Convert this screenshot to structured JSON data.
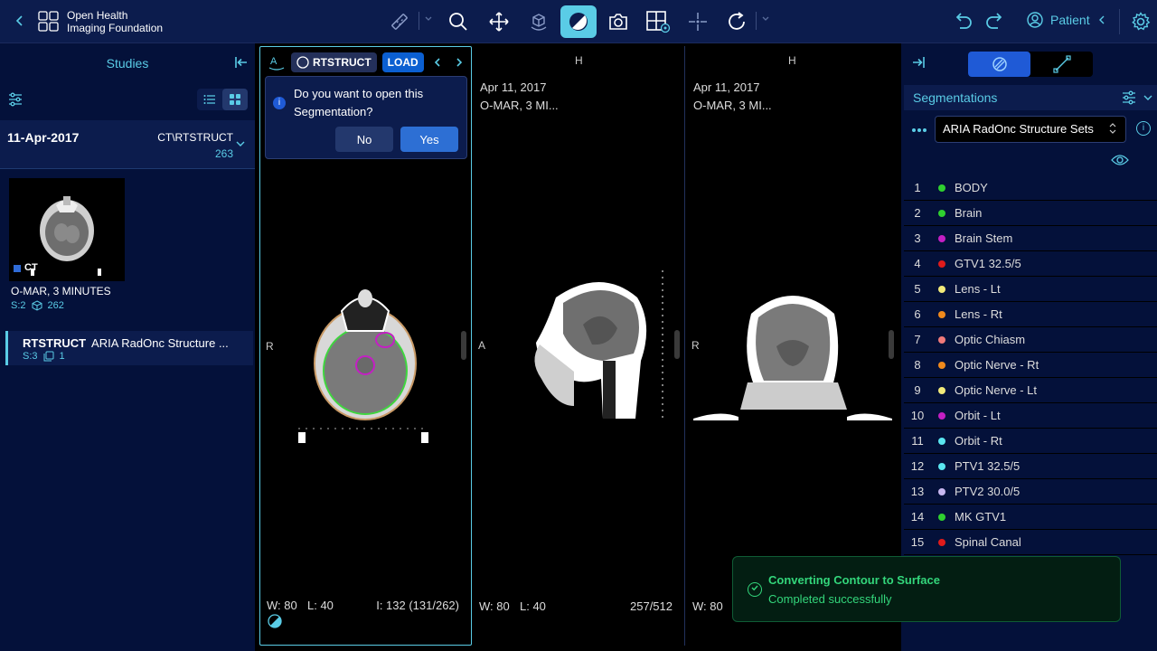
{
  "header": {
    "logo_line1": "Open Health",
    "logo_line2": "Imaging Foundation",
    "patient_label": "Patient"
  },
  "left_panel": {
    "title": "Studies",
    "study": {
      "date": "11-Apr-2017",
      "modalities": "CT\\RTSTRUCT",
      "instance_count": "263"
    },
    "series_thumbnail": {
      "badge": "CT",
      "description": "O-MAR, 3 MINUTES",
      "series_number": "S:2",
      "instance_count": "262"
    },
    "rtstruct_item": {
      "modality": "RTSTRUCT",
      "description": "ARIA RadOnc Structure ...",
      "series_number": "S:3",
      "instance_count": "1"
    }
  },
  "viewport1": {
    "seg_label": "RTSTRUCT",
    "load_label": "LOAD",
    "prompt_text": "Do you want to open this Segmentation?",
    "no_label": "No",
    "yes_label": "Yes",
    "orient_left": "R",
    "window": "W: 80",
    "level": "L: 40",
    "image_index": "I: 132 (131/262)"
  },
  "viewport2": {
    "orient_top": "H",
    "orient_left": "A",
    "date": "Apr 11, 2017",
    "series": "O-MAR, 3 MI...",
    "window": "W: 80",
    "level": "L: 40",
    "slice": "257/512"
  },
  "viewport3": {
    "orient_top": "H",
    "orient_left": "R",
    "date": "Apr 11, 2017",
    "series": "O-MAR, 3 MI...",
    "window": "W: 80"
  },
  "right_panel": {
    "segmentations_title": "Segmentations",
    "selected_set": "ARIA RadOnc Structure Sets",
    "segments": [
      {
        "num": "1",
        "label": "BODY",
        "color": "#2fd02f"
      },
      {
        "num": "2",
        "label": "Brain",
        "color": "#2fd02f"
      },
      {
        "num": "3",
        "label": "Brain Stem",
        "color": "#c41fc4"
      },
      {
        "num": "4",
        "label": "GTV1 32.5/5",
        "color": "#e01b1b"
      },
      {
        "num": "5",
        "label": "Lens - Lt",
        "color": "#f2ea7a"
      },
      {
        "num": "6",
        "label": "Lens - Rt",
        "color": "#f08a1c"
      },
      {
        "num": "7",
        "label": "Optic Chiasm",
        "color": "#f07a7a"
      },
      {
        "num": "8",
        "label": "Optic Nerve - Rt",
        "color": "#f08a1c"
      },
      {
        "num": "9",
        "label": "Optic Nerve - Lt",
        "color": "#f2ea7a"
      },
      {
        "num": "10",
        "label": "Orbit - Lt",
        "color": "#c41fc4"
      },
      {
        "num": "11",
        "label": "Orbit - Rt",
        "color": "#5ae6f0"
      },
      {
        "num": "12",
        "label": "PTV1 32.5/5",
        "color": "#5ae6f0"
      },
      {
        "num": "13",
        "label": "PTV2 30.0/5",
        "color": "#c8b8f0"
      },
      {
        "num": "14",
        "label": "MK GTV1",
        "color": "#2fd02f"
      },
      {
        "num": "15",
        "label": "Spinal Canal",
        "color": "#e01b1b"
      }
    ]
  },
  "toast": {
    "title": "Converting Contour to Surface",
    "message": "Completed successfully"
  }
}
